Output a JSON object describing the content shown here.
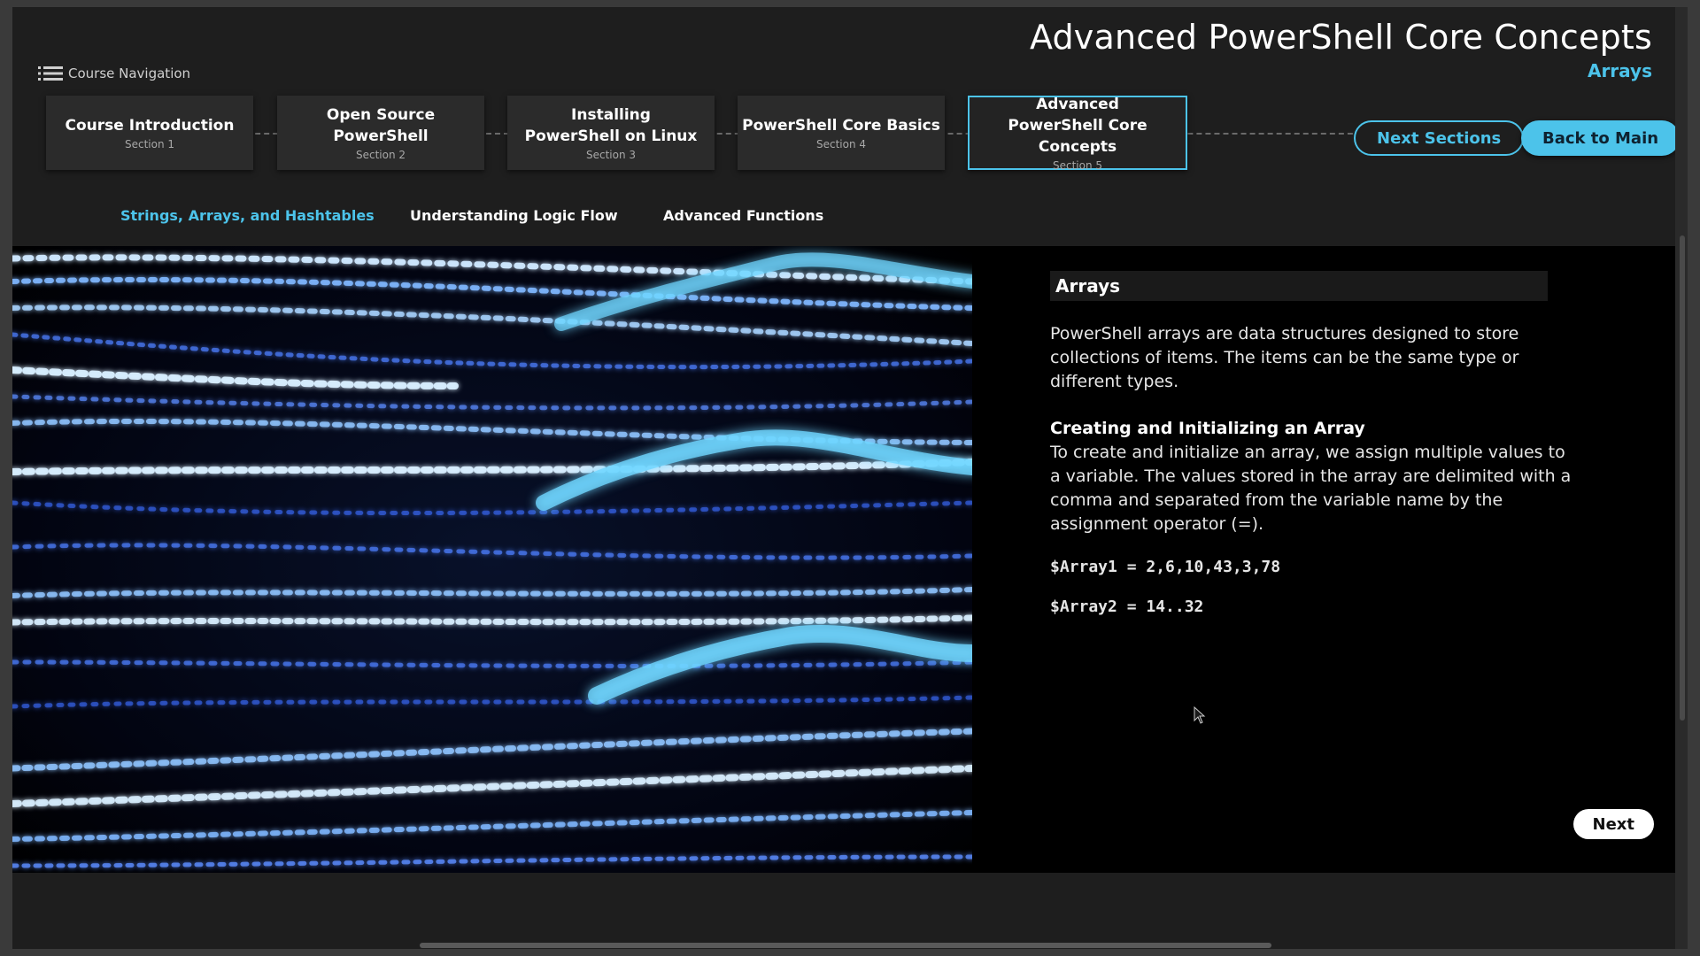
{
  "header": {
    "title": "Advanced PowerShell Core Concepts",
    "subtitle": "Arrays"
  },
  "course_nav": {
    "label": "Course Navigation",
    "icon": "list-icon"
  },
  "steps": [
    {
      "title": "Course Introduction",
      "section": "Section 1"
    },
    {
      "title": "Open Source PowerShell",
      "section": "Section 2"
    },
    {
      "title": "Installing PowerShell on Linux",
      "section": "Section 3"
    },
    {
      "title": "PowerShell Core Basics",
      "section": "Section 4"
    },
    {
      "title": "Advanced PowerShell Core Concepts",
      "section": "Section 5"
    }
  ],
  "buttons": {
    "next_sections": "Next Sections",
    "back_to_main": "Back to Main",
    "next": "Next"
  },
  "subtabs": [
    {
      "label": "Strings, Arrays, and Hashtables"
    },
    {
      "label": "Understanding Logic Flow"
    },
    {
      "label": "Advanced Functions"
    }
  ],
  "content": {
    "heading": "Arrays",
    "intro": "PowerShell arrays are data structures designed to store collections of items. The items can be the same type or different types.",
    "subheading": "Creating and Initializing an Array",
    "body": "To create and initialize an array, we assign multiple values to a variable. The values stored in the array are delimited with a comma and separated from the variable name by the assignment operator (=).",
    "code": [
      "$Array1 = 2,6,10,43,3,78",
      "$Array2 = 14..32"
    ]
  },
  "colors": {
    "accent": "#4cc3ea",
    "background": "#1e1e1e",
    "content_bg": "#000000"
  }
}
